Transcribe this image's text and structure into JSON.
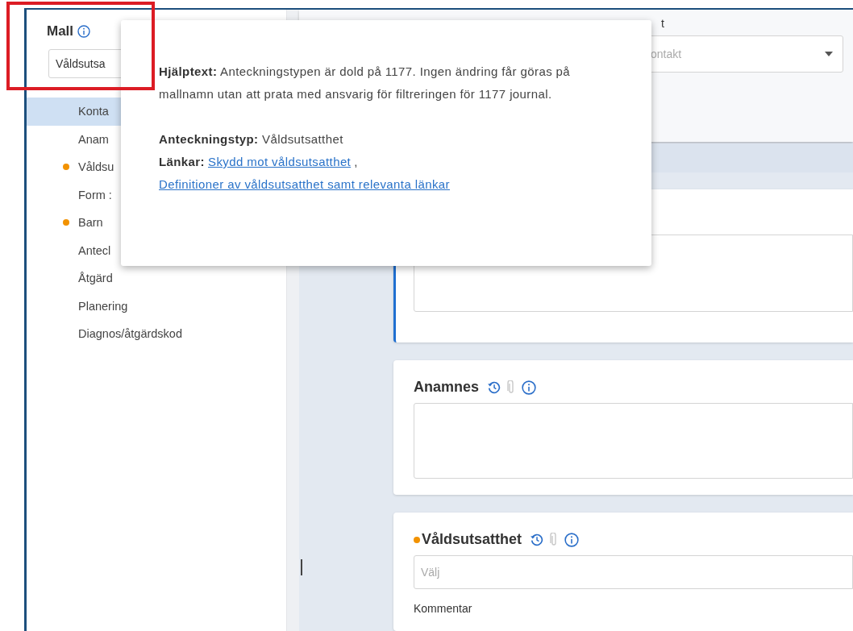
{
  "sidebar": {
    "title": "Mall",
    "template_select": {
      "value": "Våldsutsa"
    },
    "items": [
      {
        "label": "Konta",
        "selected": true,
        "dot": false
      },
      {
        "label": "Anam",
        "selected": false,
        "dot": false
      },
      {
        "label": "Våldsu",
        "selected": false,
        "dot": true
      },
      {
        "label": "Form :",
        "selected": false,
        "dot": false
      },
      {
        "label": "Barn",
        "selected": false,
        "dot": true
      },
      {
        "label": "Antecl",
        "selected": false,
        "dot": false
      },
      {
        "label": "Åtgärd",
        "selected": false,
        "dot": false
      },
      {
        "label": "Planering",
        "selected": false,
        "dot": false
      },
      {
        "label": "Diagnos/åtgärdskod",
        "selected": false,
        "dot": false
      }
    ]
  },
  "header": {
    "label": "t",
    "select": {
      "value": "ontakt"
    }
  },
  "cards": [
    {
      "active": true,
      "fields": [
        {
          "kind": "textarea"
        }
      ]
    },
    {
      "title": "Anamnes",
      "dot": false,
      "active": false,
      "fields": [
        {
          "kind": "textarea"
        }
      ]
    },
    {
      "title": "Våldsutsatthet",
      "dot": true,
      "active": false,
      "fields": [
        {
          "kind": "select",
          "placeholder": "Välj"
        },
        {
          "kind": "label",
          "text": "Kommentar"
        }
      ]
    }
  ],
  "tooltip": {
    "help": "**Hjälptext:** Anteckningstypen är dold på 1177. Ingen ändring får göras på mallnamn utan att prata med ansvarig för filtreringen för 1177 journal.",
    "note_type": "**Anteckningstyp:** Våldsutsatthet",
    "links_label": "Länkar:",
    "links": [
      "Skydd mot våldsutsatthet",
      "Definitioner av våldsutsatthet samt relevanta länkar"
    ],
    "separator": ","
  }
}
